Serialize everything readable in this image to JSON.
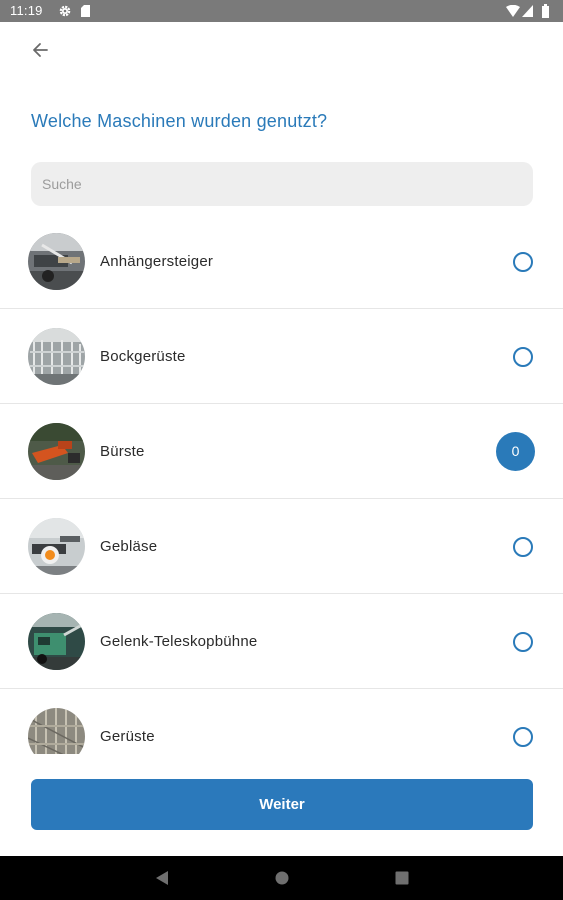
{
  "status_bar": {
    "time": "11:19"
  },
  "header": {
    "title": "Welche Maschinen wurden genutzt?"
  },
  "search": {
    "placeholder": "Suche",
    "value": ""
  },
  "machines": [
    {
      "label": "Anhängersteiger",
      "selected": false,
      "count": null
    },
    {
      "label": "Bockgerüste",
      "selected": false,
      "count": null
    },
    {
      "label": "Bürste",
      "selected": true,
      "count": "0"
    },
    {
      "label": "Gebläse",
      "selected": false,
      "count": null
    },
    {
      "label": "Gelenk-Teleskopbühne",
      "selected": false,
      "count": null
    },
    {
      "label": "Gerüste",
      "selected": false,
      "count": null
    }
  ],
  "footer": {
    "continue_label": "Weiter"
  },
  "colors": {
    "accent": "#2a7ab9",
    "status_bar": "#7a7a7a",
    "nav_bar": "#000000"
  }
}
